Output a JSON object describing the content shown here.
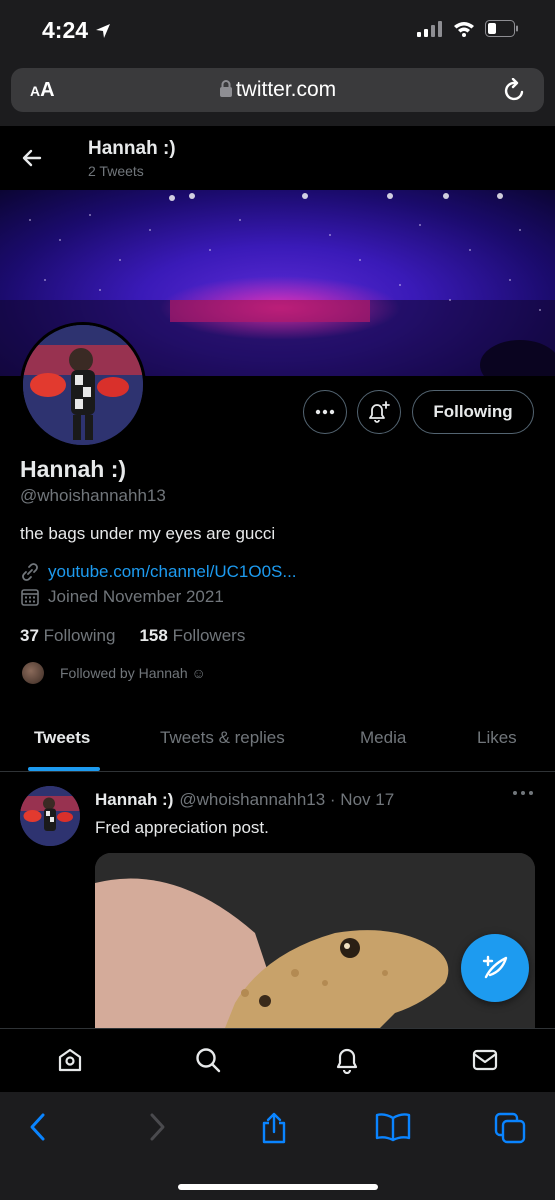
{
  "status_bar": {
    "time": "4:24"
  },
  "browser": {
    "text_size_label_big": "A",
    "text_size_label_small": "A",
    "url": "twitter.com"
  },
  "header": {
    "name": "Hannah :)",
    "tweet_count": "2 Tweets"
  },
  "profile": {
    "name": "Hannah :)",
    "handle": "@whoishannahh13",
    "bio": "the bags under my eyes are gucci",
    "link": "youtube.com/channel/UC1O0S...",
    "joined": "Joined November 2021",
    "following_count": "37",
    "following_label": "Following",
    "followers_count": "158",
    "followers_label": "Followers",
    "followed_by": "Followed by Hannah ☺︎",
    "following_button": "Following"
  },
  "tabs": [
    {
      "label": "Tweets",
      "active": true
    },
    {
      "label": "Tweets & replies"
    },
    {
      "label": "Media"
    },
    {
      "label": "Likes"
    }
  ],
  "tweet": {
    "name": "Hannah :)",
    "meta": "@whoishannahh13 · Nov 17",
    "text": "Fred appreciation post."
  },
  "colors": {
    "accent": "#1d9bf0",
    "background": "#000000",
    "muted": "#71767b"
  },
  "icons": {
    "status": [
      "location-arrow-icon",
      "signal-icon",
      "wifi-icon",
      "battery-icon"
    ],
    "nav": [
      "home-icon",
      "search-icon",
      "notifications-icon",
      "messages-icon"
    ],
    "toolbar": [
      "back-icon",
      "forward-icon",
      "share-icon",
      "bookmarks-icon",
      "tabs-icon"
    ]
  }
}
